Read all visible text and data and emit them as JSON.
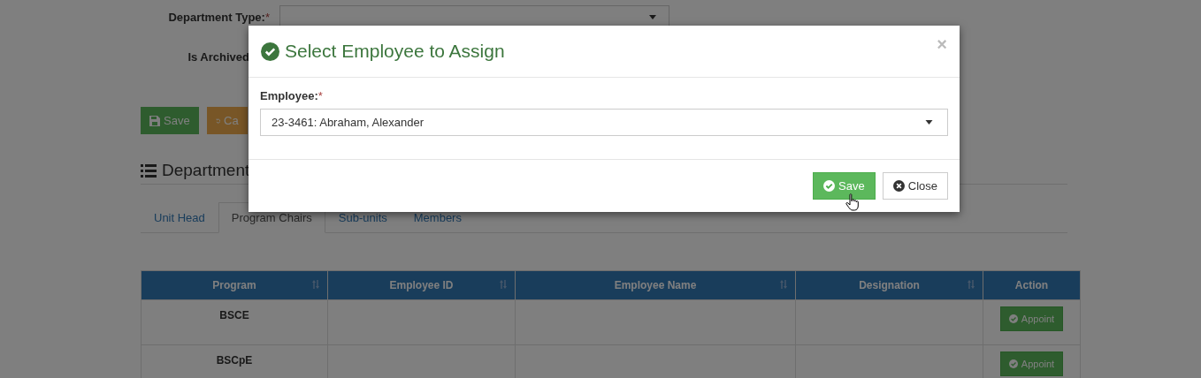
{
  "form": {
    "fields": [
      {
        "label": "Department Type:",
        "required_mark": "*",
        "kind": "select"
      },
      {
        "label": "Is Archived",
        "kind": "text"
      }
    ],
    "buttons": [
      {
        "label": "Save",
        "kind": "save"
      },
      {
        "label": "Ca",
        "kind": "cancel"
      }
    ]
  },
  "section": {
    "title": "Department"
  },
  "tabs": [
    {
      "label": "Unit Head",
      "selected": false
    },
    {
      "label": "Program Chairs",
      "selected": true
    },
    {
      "label": "Sub-units",
      "selected": false
    },
    {
      "label": "Members",
      "selected": false
    }
  ],
  "table": {
    "columns": [
      {
        "label": "Program",
        "sortable": true
      },
      {
        "label": "Employee ID",
        "sortable": true
      },
      {
        "label": "Employee Name",
        "sortable": true
      },
      {
        "label": "Designation",
        "sortable": true
      },
      {
        "label": "Action",
        "sortable": false
      }
    ],
    "rows": [
      {
        "program": "BSCE",
        "action": "Appoint"
      },
      {
        "program": "BSCpE",
        "action": "Appoint"
      }
    ]
  },
  "modal": {
    "title": "Select Employee to Assign",
    "close": "×",
    "field": {
      "label": "Employee:",
      "required_mark": "*",
      "value": "23-3461: Abraham, Alexander"
    },
    "buttons": [
      {
        "label": "Save",
        "kind": "primary"
      },
      {
        "label": "Close",
        "kind": "default"
      }
    ]
  }
}
